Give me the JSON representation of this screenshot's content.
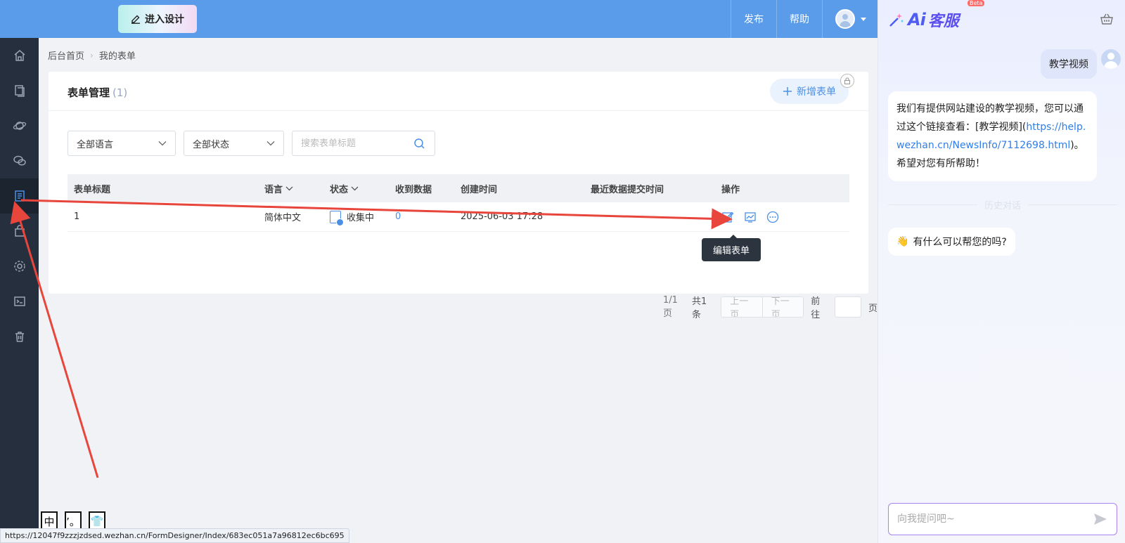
{
  "topbar": {
    "design_button": "进入设计",
    "publish": "发布",
    "help": "帮助"
  },
  "sidebar": {
    "items": [
      "home-icon",
      "pages-icon",
      "planet-icon",
      "chat-icon",
      "form-icon",
      "bag-icon",
      "settings-icon",
      "terminal-icon",
      "trash-icon"
    ],
    "active": "form-icon"
  },
  "breadcrumb": {
    "home": "后台首页",
    "current": "我的表单"
  },
  "card": {
    "title": "表单管理",
    "count": "(1)",
    "add_button": "新增表单"
  },
  "filters": {
    "language": "全部语言",
    "status": "全部状态",
    "search_placeholder": "搜索表单标题"
  },
  "table": {
    "headers": {
      "title": "表单标题",
      "language": "语言",
      "status": "状态",
      "received": "收到数据",
      "created": "创建时间",
      "last_submit": "最近数据提交时间",
      "actions": "操作"
    },
    "rows": [
      {
        "title": "1",
        "language": "简体中文",
        "status": "收集中",
        "received": "0",
        "created": "2025-06-03 17:28",
        "last_submit": ""
      }
    ]
  },
  "tooltip": "编辑表单",
  "pager": {
    "pages": "1/1页",
    "total": "共1条",
    "prev": "上一页",
    "next": "下一页",
    "goto": "前往",
    "page_unit": "页"
  },
  "chat": {
    "brand_ai": "Ai",
    "brand_name": "客服",
    "beta": "Beta",
    "user_message": "教学视频",
    "bot_text_1": "我们有提供网站建设的教学视频，您可以通过这个链接查看：[教学视频](",
    "bot_link": "https://help.wezhan.cn/NewsInfo/7112698.html",
    "bot_text_2": ")。希望对您有所帮助！",
    "history_label": "历史对话",
    "greeting_emoji": "👋",
    "greeting": "有什么可以帮您的吗?",
    "input_placeholder": "向我提问吧~"
  },
  "status_url": "https://12047f9zzzjzdsed.wezhan.cn/FormDesigner/Index/683ec051a7a96812ec6bc695",
  "ime_keys": [
    "中",
    "’。",
    "👕"
  ],
  "colors": {
    "topbar": "#5a9cea",
    "sidebar": "#262f3e",
    "accent": "#4a8fe6",
    "annotation_arrow": "#e8453c"
  }
}
